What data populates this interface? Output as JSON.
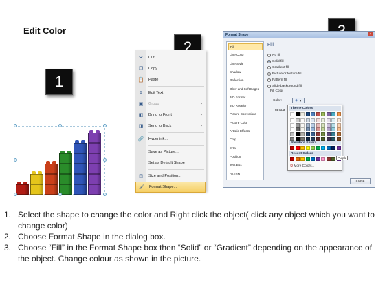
{
  "title": "Edit Color",
  "badges": [
    "1",
    "2",
    "3"
  ],
  "context_menu": {
    "items": [
      {
        "label": "Cut",
        "icon": "scissors-icon",
        "glyph": "✂"
      },
      {
        "label": "Copy",
        "icon": "copy-icon",
        "glyph": "❐"
      },
      {
        "label": "Paste",
        "icon": "paste-icon",
        "glyph": "📋"
      },
      {
        "label": "Edit Text",
        "icon": "edit-text-icon",
        "glyph": "A"
      },
      {
        "label": "Group",
        "icon": "group-icon",
        "glyph": "▣",
        "disabled": true,
        "submenu": true
      },
      {
        "label": "Bring to Front",
        "icon": "bring-front-icon",
        "glyph": "◧",
        "submenu": true
      },
      {
        "label": "Send to Back",
        "icon": "send-back-icon",
        "glyph": "◨",
        "submenu": true
      },
      {
        "label": "Hyperlink...",
        "icon": "hyperlink-icon",
        "glyph": "🔗"
      },
      {
        "label": "Save as Picture...",
        "icon": "",
        "glyph": ""
      },
      {
        "label": "Set as Default Shape",
        "icon": "",
        "glyph": ""
      },
      {
        "label": "Size and Position...",
        "icon": "size-position-icon",
        "glyph": "⊡"
      },
      {
        "label": "Format Shape...",
        "icon": "format-shape-icon",
        "glyph": "🖌",
        "highlighted": true
      }
    ]
  },
  "dialog": {
    "title": "Format Shape",
    "nav": [
      "Fill",
      "Line Color",
      "Line Style",
      "Shadow",
      "Reflection",
      "Glow and Soft Edges",
      "3-D Format",
      "3-D Rotation",
      "Picture Corrections",
      "Picture Color",
      "Artistic Effects",
      "Crop",
      "Size",
      "Position",
      "Text Box",
      "Alt Text"
    ],
    "active_nav": "Fill",
    "heading": "Fill",
    "options": [
      {
        "label": "No fill",
        "selected": false
      },
      {
        "label": "Solid fill",
        "selected": true
      },
      {
        "label": "Gradient fill",
        "selected": false
      },
      {
        "label": "Picture or texture fill",
        "selected": false
      },
      {
        "label": "Pattern fill",
        "selected": false
      },
      {
        "label": "Slide background fill",
        "selected": false
      }
    ],
    "fill_color_label": "Fill Color",
    "color_label": "Color:",
    "transparency_label": "Transpa",
    "close_label": "Close"
  },
  "palette": {
    "theme_heading": "Theme Colors",
    "standard_heading": "Standard Colors",
    "recent_heading": "Recent Colors",
    "more_label": "More Colors...",
    "tooltip": "Purple",
    "theme_top": [
      "#ffffff",
      "#000000",
      "#eeece1",
      "#1f497d",
      "#4f81bd",
      "#c0504d",
      "#9bbb59",
      "#8064a2",
      "#4bacc6",
      "#f79646"
    ],
    "standard": [
      "#c00000",
      "#ff0000",
      "#ffc000",
      "#ffff00",
      "#92d050",
      "#00b050",
      "#00b0f0",
      "#0070c0",
      "#002060",
      "#7030a0"
    ],
    "recent": [
      "#c00000",
      "#e46c0a",
      "#ffc000",
      "#00b050",
      "#0070c0",
      "#7030a0",
      "#ff99cc",
      "#953735",
      "#4f6228",
      "#7030a0"
    ]
  },
  "chart_bars": [
    {
      "color": "#b01c14",
      "dark": "#7a1410",
      "levels": 1
    },
    {
      "color": "#e5c51b",
      "dark": "#b59a12",
      "levels": 2
    },
    {
      "color": "#c9401a",
      "dark": "#8f2c12",
      "levels": 3
    },
    {
      "color": "#2a8c2a",
      "dark": "#1b621b",
      "levels": 4
    },
    {
      "color": "#2f55b8",
      "dark": "#203d86",
      "levels": 5
    },
    {
      "color": "#7d3fb0",
      "dark": "#5a2c82",
      "levels": 6
    }
  ],
  "instructions": [
    {
      "num": "1.",
      "text": "Select the shape to change the color and Right click the object( click any object which you want to change color)"
    },
    {
      "num": "2.",
      "text": "Choose Format Shape in the dialog box."
    },
    {
      "num": "3.",
      "text": "Choose “Fill” in the Format Shape box then “Solid” or “Gradient” depending on the appearance of the object. Change colour as shown in the picture."
    }
  ]
}
